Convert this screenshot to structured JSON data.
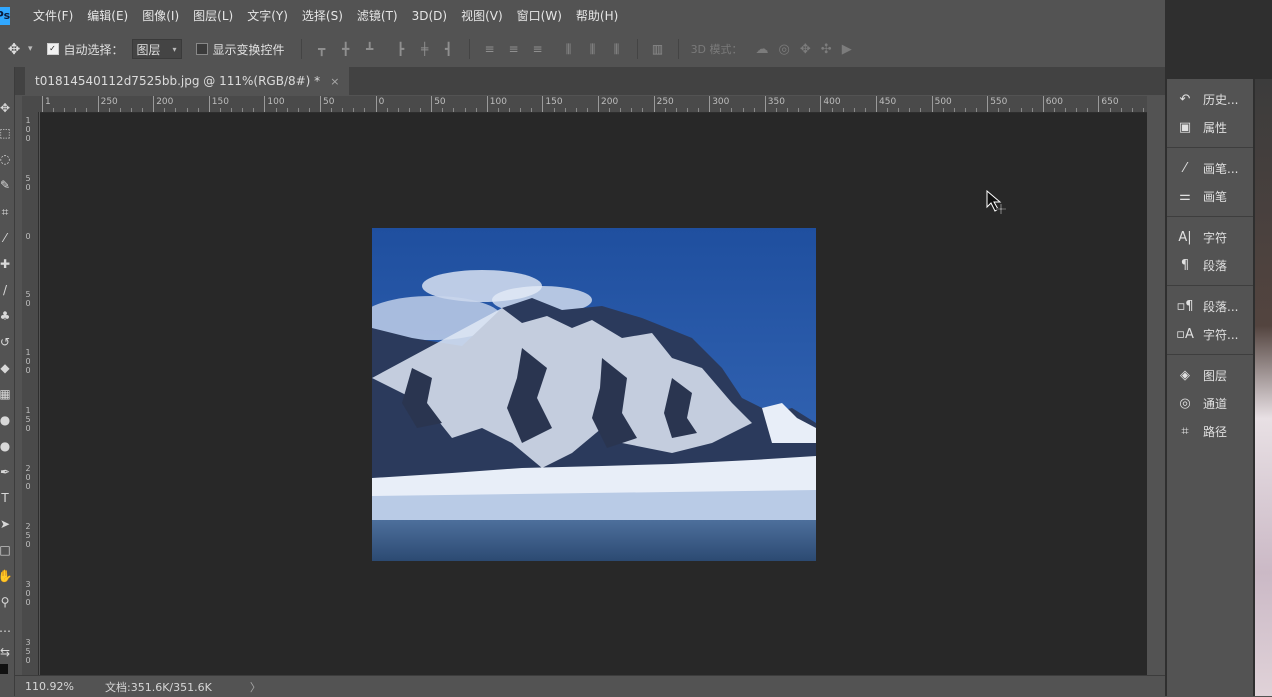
{
  "menubar": {
    "app_icon": "Ps",
    "items": [
      "文件(F)",
      "编辑(E)",
      "图像(I)",
      "图层(L)",
      "文字(Y)",
      "选择(S)",
      "滤镜(T)",
      "3D(D)",
      "视图(V)",
      "窗口(W)",
      "帮助(H)"
    ]
  },
  "options": {
    "auto_select_label": "自动选择：",
    "auto_select_checked": true,
    "layer_select_value": "图层",
    "show_transform_label": "显示变换控件",
    "show_transform_checked": false,
    "mode_3d_label": "3D 模式："
  },
  "document": {
    "tab_title": "t01814540112d7525bb.jpg @ 111%(RGB/8#) *",
    "close_glyph": "×"
  },
  "ruler": {
    "h_labels": [
      "1",
      "250",
      "200",
      "150",
      "100",
      "50",
      "0",
      "50",
      "100",
      "150",
      "200",
      "250",
      "300",
      "350",
      "400",
      "450",
      "500",
      "550",
      "600",
      "650"
    ],
    "v_labels": [
      "1\n0\n0",
      "5\n0",
      "0",
      "5\n0",
      "1\n0\n0",
      "1\n5\n0",
      "2\n0\n0",
      "2\n5\n0",
      "3\n0\n0",
      "3\n5\n0"
    ]
  },
  "status": {
    "zoom": "110.92%",
    "doc_info": "文档:351.6K/351.6K",
    "arrow": "〉"
  },
  "panels": {
    "groups": [
      [
        {
          "icon": "history-icon",
          "label": "历史..."
        },
        {
          "icon": "properties-icon",
          "label": "属性"
        }
      ],
      [
        {
          "icon": "brush-presets-icon",
          "label": "画笔..."
        },
        {
          "icon": "brush-settings-icon",
          "label": "画笔"
        }
      ],
      [
        {
          "icon": "character-icon",
          "label": "字符"
        },
        {
          "icon": "paragraph-icon",
          "label": "段落"
        }
      ],
      [
        {
          "icon": "paragraph-styles-icon",
          "label": "段落..."
        },
        {
          "icon": "character-styles-icon",
          "label": "字符..."
        }
      ],
      [
        {
          "icon": "layers-icon",
          "label": "图层"
        },
        {
          "icon": "channels-icon",
          "label": "通道"
        },
        {
          "icon": "paths-icon",
          "label": "路径"
        }
      ]
    ]
  },
  "colors": {
    "ui_bg": "#535353",
    "canvas_bg": "#282828",
    "sky": "#2456a4",
    "snow": "#e8eef8",
    "rock": "#2a3550"
  }
}
